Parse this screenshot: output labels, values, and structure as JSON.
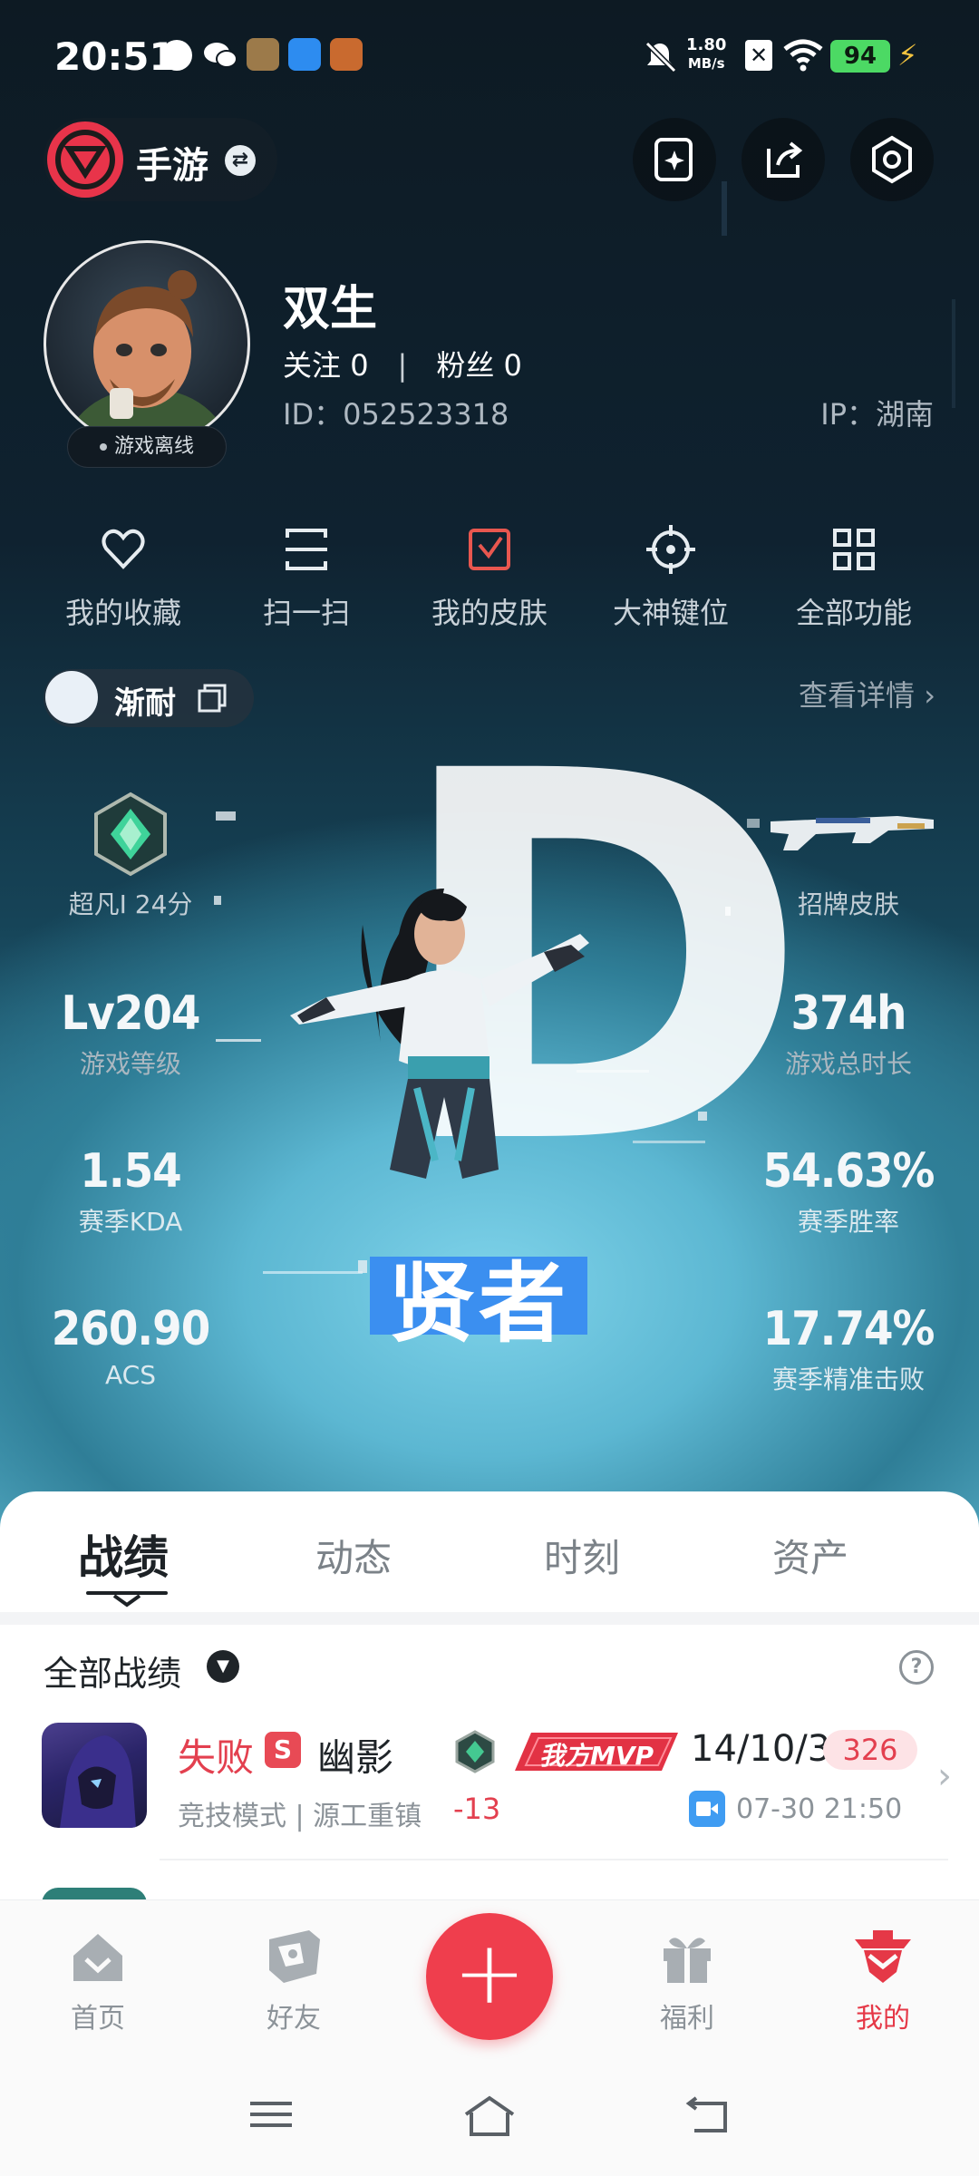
{
  "status_bar": {
    "time": "20:51",
    "net_speed_value": "1.80",
    "net_speed_unit": "MB/s",
    "battery": "94"
  },
  "top_bar": {
    "brand": "手游"
  },
  "profile": {
    "name": "双生",
    "follow_label": "关注",
    "follow_count": "0",
    "separator": "|",
    "fans_label": "粉丝",
    "fans_count": "0",
    "id_text": "ID：052523318",
    "ip_text": "IP：湖南",
    "status": "游戏离线"
  },
  "quick_menu": [
    {
      "label": "我的收藏",
      "icon": "heart-icon"
    },
    {
      "label": "扫一扫",
      "icon": "scan-icon"
    },
    {
      "label": "我的皮肤",
      "icon": "skin-icon"
    },
    {
      "label": "大神键位",
      "icon": "crosshair-icon"
    },
    {
      "label": "全部功能",
      "icon": "grid-icon"
    }
  ],
  "game_tag": {
    "name": "渐耐",
    "detail_link": "查看详情 ›"
  },
  "stats": {
    "rank": {
      "label": "超凡I 24分"
    },
    "signature_skin": {
      "label": "招牌皮肤"
    },
    "level": {
      "value": "Lv204",
      "label": "游戏等级"
    },
    "play_time": {
      "value": "374h",
      "label": "游戏总时长"
    },
    "kda": {
      "value": "1.54",
      "label": "赛季KDA"
    },
    "win_rate": {
      "value": "54.63%",
      "label": "赛季胜率"
    },
    "acs": {
      "value": "260.90",
      "label": "ACS"
    },
    "precise_kill": {
      "value": "17.74%",
      "label": "赛季精准击败"
    },
    "rank_letter": "D",
    "rank_title": "贤者"
  },
  "tabs": [
    {
      "label": "战绩",
      "active": true
    },
    {
      "label": "动态",
      "active": false
    },
    {
      "label": "时刻",
      "active": false
    },
    {
      "label": "资产",
      "active": false
    }
  ],
  "records": {
    "filter_label": "全部战绩",
    "matches": [
      {
        "result": "失败",
        "badge": "S",
        "hero": "幽影",
        "mode": "竞技模式 | 源工重镇",
        "delta": "-13",
        "mvp": "我方MVP",
        "kda": "14/10/3",
        "score": "326",
        "datetime": "07-30 21:50"
      }
    ]
  },
  "bottom_nav": [
    {
      "label": "首页",
      "active": false
    },
    {
      "label": "好友",
      "active": false
    },
    {
      "label": "福利",
      "active": false
    },
    {
      "label": "我的",
      "active": true
    }
  ],
  "colors": {
    "accent_red": "#ef3e4d",
    "hero_blue": "#5cb7d2",
    "rank_blue": "#3b8ff0"
  }
}
